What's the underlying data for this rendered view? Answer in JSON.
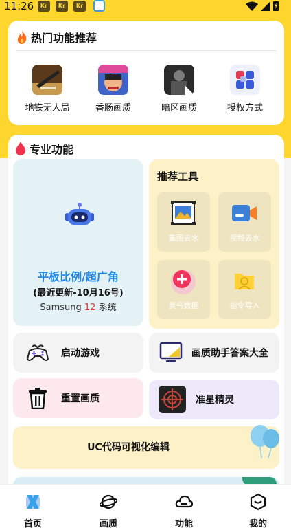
{
  "status_bar": {
    "time": "11:26",
    "badges": [
      "Kr",
      "Kr",
      "Kr"
    ]
  },
  "hot": {
    "title": "热门功能推荐",
    "items": [
      {
        "label": "地铁无人局",
        "icon": "metro-game-icon"
      },
      {
        "label": "香肠画质",
        "icon": "sausage-game-icon"
      },
      {
        "label": "暗区画质",
        "icon": "dark-zone-game-icon"
      },
      {
        "label": "授权方式",
        "icon": "authorize-icon"
      }
    ]
  },
  "pro": {
    "title": "专业功能",
    "tablet": {
      "title": "平板比例/超广角",
      "subtitle": "(最近更新-10月16号)",
      "system_prefix": "Samsung",
      "system_version": "12",
      "system_suffix": "系统"
    },
    "tools": {
      "title": "推荐工具",
      "items": [
        {
          "label": "集图去水",
          "icon": "image-frame-icon"
        },
        {
          "label": "视频去水",
          "icon": "video-camera-icon"
        },
        {
          "label": "黄鸟数据",
          "icon": "plus-circle-icon"
        },
        {
          "label": "指令导入",
          "icon": "folder-icon"
        }
      ]
    },
    "buttons": {
      "start_game": "启动游戏",
      "quality_answers": "画质助手答案大全",
      "reset_quality": "重置画质",
      "crosshair": "准星精灵",
      "uc_editor": "UC代码可视化编辑"
    }
  },
  "nav": {
    "items": [
      {
        "label": "首页",
        "active": true
      },
      {
        "label": "画质",
        "active": false
      },
      {
        "label": "功能",
        "active": false
      },
      {
        "label": "我的",
        "active": false
      }
    ]
  },
  "colors": {
    "brand_yellow": "#ffd62e",
    "accent_blue": "#1e88e5",
    "highlight_red": "#e53935"
  }
}
